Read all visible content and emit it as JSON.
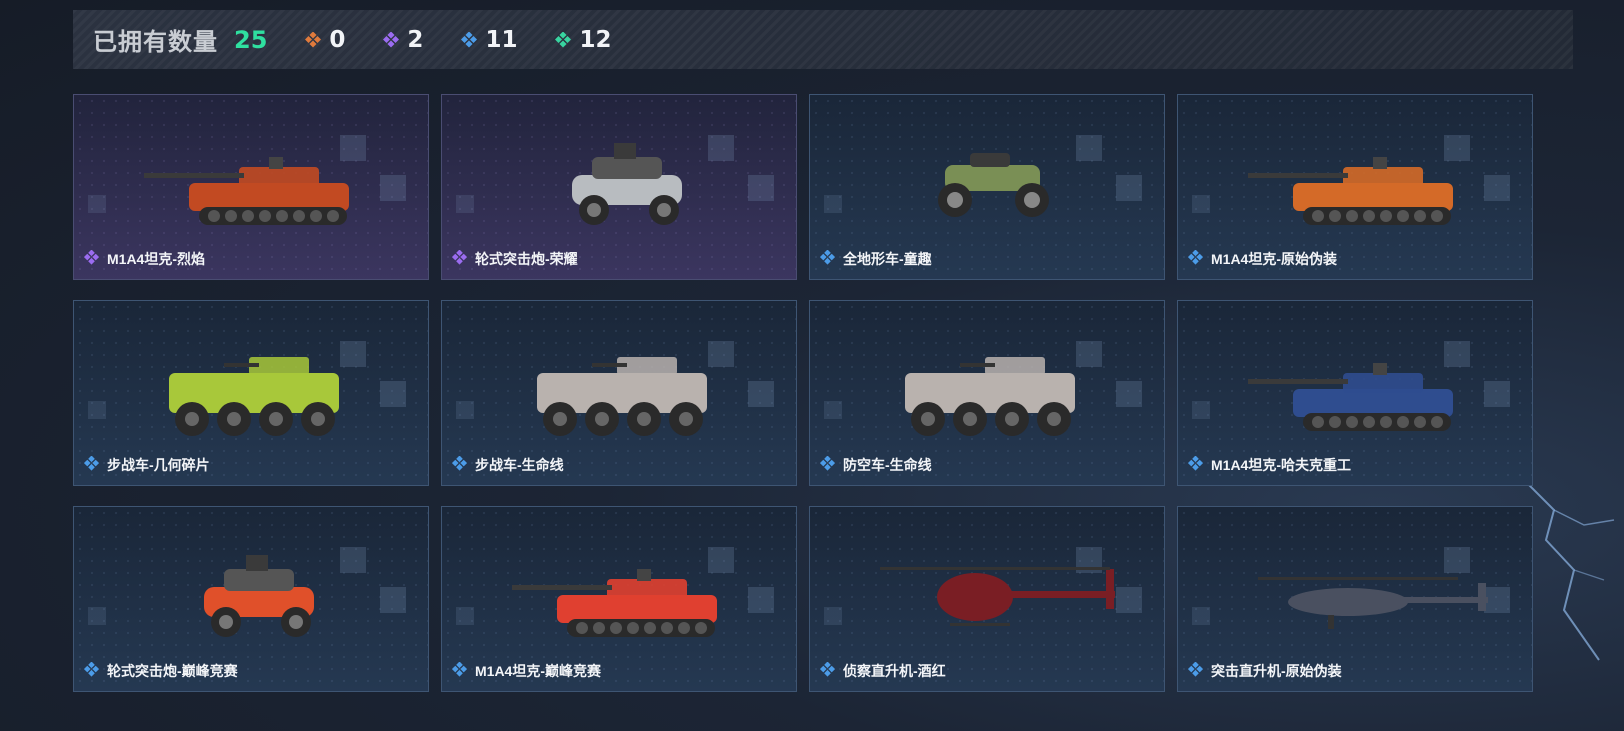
{
  "header": {
    "label": "已拥有数量",
    "total": "25",
    "rarities": [
      {
        "name": "orange-diamond-icon",
        "color": "#e07a3c",
        "count": "0"
      },
      {
        "name": "purple-diamond-icon",
        "color": "#9b6cf0",
        "count": "2"
      },
      {
        "name": "blue-diamond-icon",
        "color": "#4c9ce8",
        "count": "11"
      },
      {
        "name": "green-diamond-icon",
        "color": "#38d4a0",
        "count": "12"
      }
    ]
  },
  "cards": [
    {
      "name": "M1A4坦克-烈焰",
      "rarity": "epic",
      "icon": "purple-diamond-icon",
      "vehicle": "tank"
    },
    {
      "name": "轮式突击炮-荣耀",
      "rarity": "epic",
      "icon": "purple-diamond-icon",
      "vehicle": "buggy"
    },
    {
      "name": "全地形车-童趣",
      "rarity": "rare",
      "icon": "blue-diamond-icon",
      "vehicle": "atv"
    },
    {
      "name": "M1A4坦克-原始伪装",
      "rarity": "rare",
      "icon": "blue-diamond-icon",
      "vehicle": "tank"
    },
    {
      "name": "步战车-几何碎片",
      "rarity": "rare",
      "icon": "blue-diamond-icon",
      "vehicle": "ifv"
    },
    {
      "name": "步战车-生命线",
      "rarity": "rare",
      "icon": "blue-diamond-icon",
      "vehicle": "ifv"
    },
    {
      "name": "防空车-生命线",
      "rarity": "rare",
      "icon": "blue-diamond-icon",
      "vehicle": "ifv"
    },
    {
      "name": "M1A4坦克-哈夫克重工",
      "rarity": "rare",
      "icon": "blue-diamond-icon",
      "vehicle": "tank"
    },
    {
      "name": "轮式突击炮-巅峰竞赛",
      "rarity": "rare",
      "icon": "blue-diamond-icon",
      "vehicle": "buggy"
    },
    {
      "name": "M1A4坦克-巅峰竞赛",
      "rarity": "rare",
      "icon": "blue-diamond-icon",
      "vehicle": "tank"
    },
    {
      "name": "侦察直升机-酒红",
      "rarity": "rare",
      "icon": "blue-diamond-icon",
      "vehicle": "scout-heli"
    },
    {
      "name": "突击直升机-原始伪装",
      "rarity": "rare",
      "icon": "blue-diamond-icon",
      "vehicle": "attack-heli"
    }
  ],
  "colors": {
    "tank-0": "#c24a22",
    "buggy-1": "#b8bcc0",
    "atv-2": "#7a8f55",
    "tank-3": "#d46a28",
    "ifv-4": "#a8c83a",
    "ifv-5": "#b9b2ae",
    "ifv-6": "#b9b2ae",
    "tank-7": "#2f4d8f",
    "buggy-8": "#e0502a",
    "tank-9": "#e04030",
    "scout-heli-10": "#7a1e24",
    "attack-heli-11": "#4a5060"
  }
}
